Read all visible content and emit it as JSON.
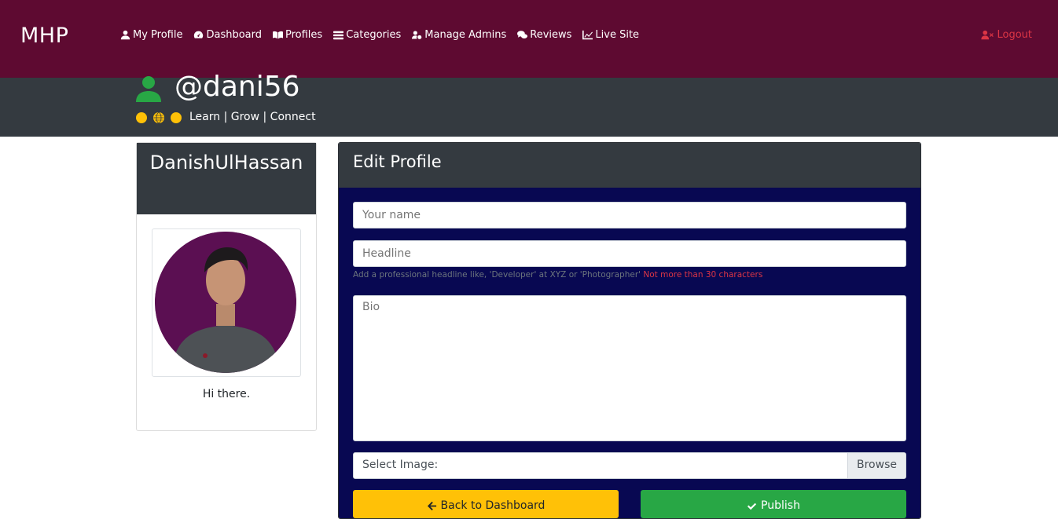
{
  "brand": "MHP",
  "nav": {
    "items": [
      {
        "label": "My Profile",
        "icon": "user-icon"
      },
      {
        "label": "Dashboard",
        "icon": "gauge-icon"
      },
      {
        "label": "Profiles",
        "icon": "book-icon"
      },
      {
        "label": "Categories",
        "icon": "list-icon"
      },
      {
        "label": "Manage Admins",
        "icon": "user-cog-icon"
      },
      {
        "label": "Reviews",
        "icon": "comments-icon"
      },
      {
        "label": "Live Site",
        "icon": "chart-line-icon"
      }
    ],
    "logout": "Logout"
  },
  "header": {
    "handle": "@dani56",
    "tagline": "Learn | Grow | Connect"
  },
  "profile_card": {
    "name": "DanishUlHassan",
    "bio": "Hi there."
  },
  "edit": {
    "title": "Edit Profile",
    "name_placeholder": "Your name",
    "headline_placeholder": "Headline",
    "headline_hint": "Add a professional headline like, 'Developer' at XYZ or 'Photographer'",
    "headline_warning": "Not more than 30 characters",
    "bio_placeholder": "Bio",
    "image_label": "Select Image:",
    "browse": "Browse",
    "back_button": "Back to Dashboard",
    "publish_button": "Publish"
  },
  "colors": {
    "navbar": "#5e0a31",
    "band": "#343a40",
    "form_bg": "#080852",
    "accent_green": "#28a745",
    "warning": "#ffc107",
    "danger": "#dc3545"
  }
}
